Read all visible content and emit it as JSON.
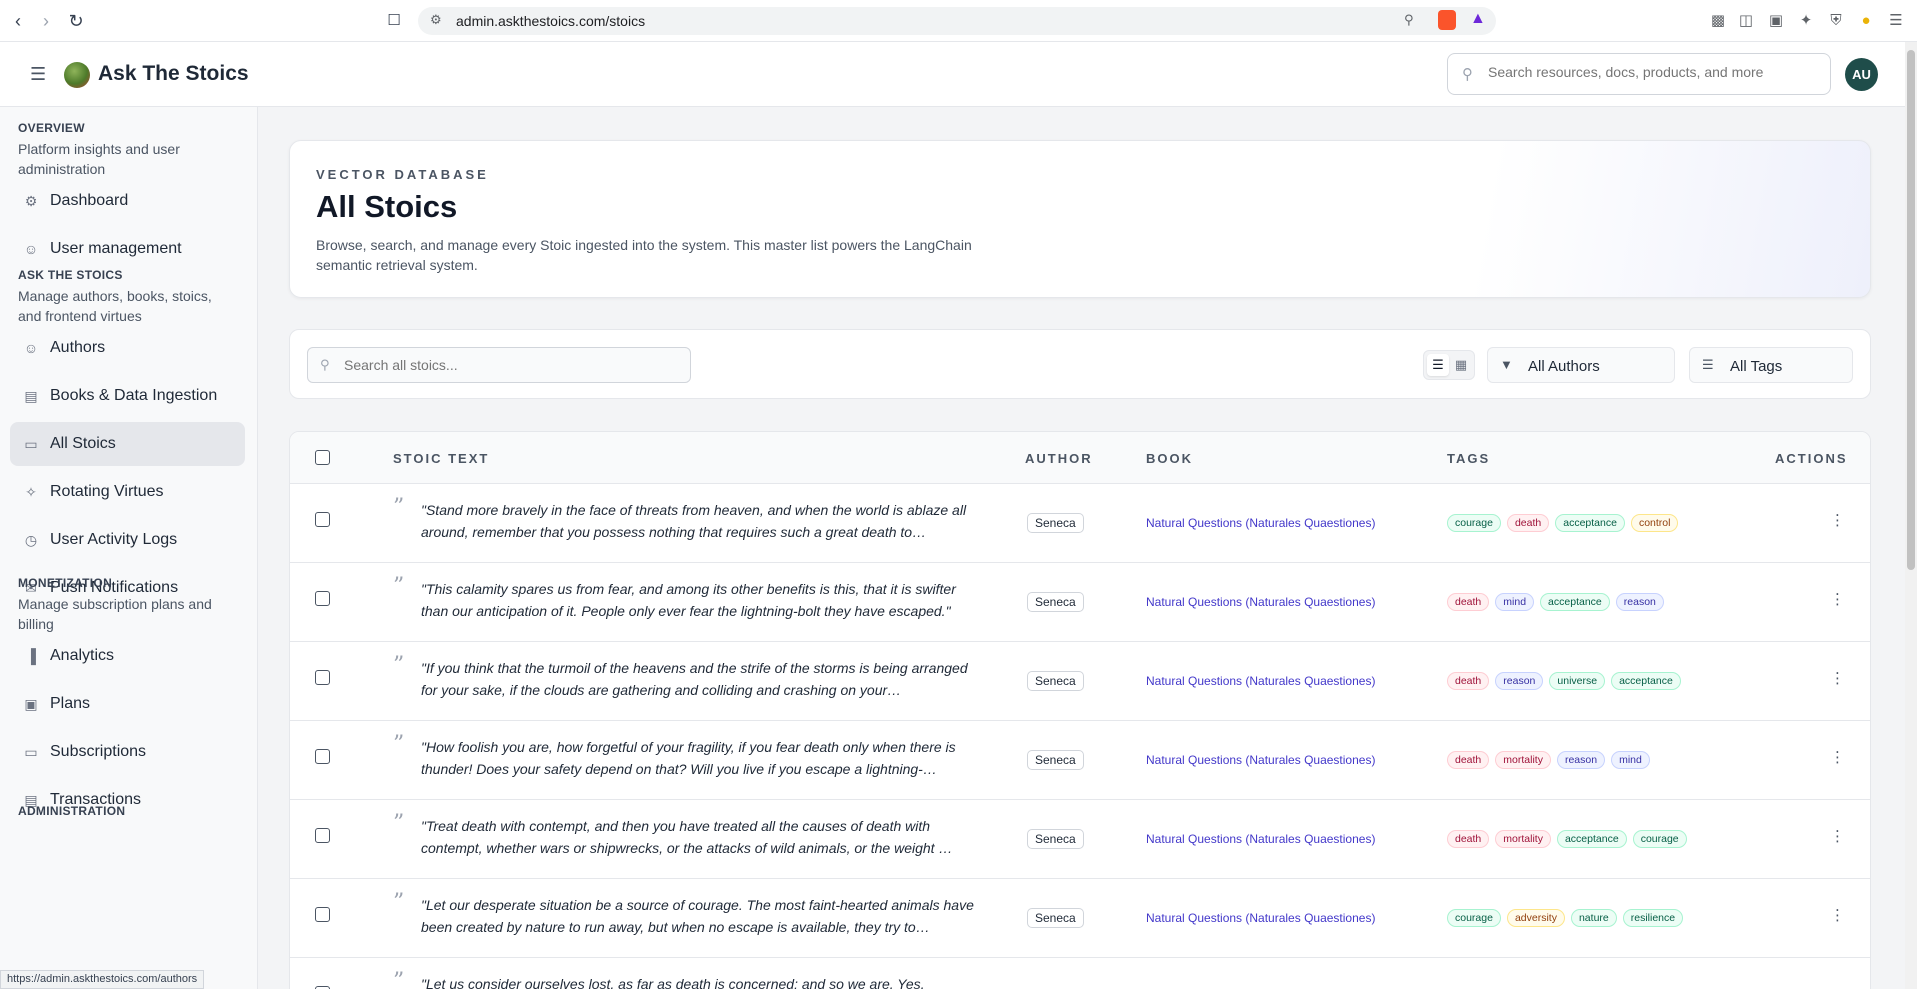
{
  "browser": {
    "url": "admin.askthestoics.com/stoics",
    "status_url": "https://admin.askthestoics.com/authors"
  },
  "header": {
    "brand": "Ask The Stoics",
    "search_placeholder": "Search resources, docs, products, and more",
    "avatar_initials": "AU"
  },
  "sidebar": {
    "sections": [
      {
        "title": "OVERVIEW",
        "desc": "Platform insights and user administration",
        "items": [
          {
            "label": "Dashboard",
            "icon": "gear-icon"
          },
          {
            "label": "User management",
            "icon": "users-icon"
          }
        ]
      },
      {
        "title": "ASK THE STOICS",
        "desc": "Manage authors, books, stoics, and frontend virtues",
        "items": [
          {
            "label": "Authors",
            "icon": "users-icon"
          },
          {
            "label": "Books & Data Ingestion",
            "icon": "book-icon"
          },
          {
            "label": "All Stoics",
            "icon": "message-icon",
            "active": true
          },
          {
            "label": "Rotating Virtues",
            "icon": "sparkles-icon"
          },
          {
            "label": "User Activity Logs",
            "icon": "clock-icon"
          },
          {
            "label": "Push Notifications",
            "icon": "mail-icon"
          }
        ]
      },
      {
        "title": "MONETIZATION",
        "desc": "Manage subscription plans and billing",
        "items": [
          {
            "label": "Analytics",
            "icon": "bar-chart-icon"
          },
          {
            "label": "Plans",
            "icon": "package-icon"
          },
          {
            "label": "Subscriptions",
            "icon": "credit-card-icon"
          },
          {
            "label": "Transactions",
            "icon": "receipt-icon"
          }
        ]
      },
      {
        "title": "ADMINISTRATION",
        "desc": "",
        "items": []
      }
    ]
  },
  "hero": {
    "eyebrow": "VECTOR DATABASE",
    "title": "All Stoics",
    "description": "Browse, search, and manage every Stoic ingested into the system. This master list powers the LangChain semantic retrieval system."
  },
  "toolbar": {
    "search_placeholder": "Search all stoics...",
    "author_filter": "All Authors",
    "tag_filter": "All Tags"
  },
  "table": {
    "columns": [
      "STOIC TEXT",
      "AUTHOR",
      "BOOK",
      "TAGS",
      "ACTIONS"
    ],
    "rows": [
      {
        "text": "\"Stand more bravely in the face of threats from heaven, and when the world is ablaze all around, remember that you possess nothing that requires such a great death to…",
        "author": "Seneca",
        "book": "Natural Questions (Naturales Quaestiones)",
        "tags": [
          "courage",
          "death",
          "acceptance",
          "control"
        ]
      },
      {
        "text": "\"This calamity spares us from fear, and among its other benefits is this, that it is swifter than our anticipation of it. People only ever fear the lightning-bolt they have escaped.\"",
        "author": "Seneca",
        "book": "Natural Questions (Naturales Quaestiones)",
        "tags": [
          "death",
          "mind",
          "acceptance",
          "reason"
        ]
      },
      {
        "text": "\"If you think that the turmoil of the heavens and the strife of the storms is being arranged for your sake, if the clouds are gathering and colliding and crashing on your…",
        "author": "Seneca",
        "book": "Natural Questions (Naturales Quaestiones)",
        "tags": [
          "death",
          "reason",
          "universe",
          "acceptance"
        ]
      },
      {
        "text": "\"How foolish you are, how forgetful of your fragility, if you fear death only when there is thunder! Does your safety depend on that? Will you live if you escape a lightning-…",
        "author": "Seneca",
        "book": "Natural Questions (Naturales Quaestiones)",
        "tags": [
          "death",
          "mortality",
          "reason",
          "mind"
        ]
      },
      {
        "text": "\"Treat death with contempt, and then you have treated all the causes of death with contempt, whether wars or shipwrecks, or the attacks of wild animals, or the weight …",
        "author": "Seneca",
        "book": "Natural Questions (Naturales Quaestiones)",
        "tags": [
          "death",
          "mortality",
          "acceptance",
          "courage"
        ]
      },
      {
        "text": "\"Let our desperate situation be a source of courage. The most faint-hearted animals have been created by nature to run away, but when no escape is available, they try to…",
        "author": "Seneca",
        "book": "Natural Questions (Naturales Quaestiones)",
        "tags": [
          "courage",
          "adversity",
          "nature",
          "resilience"
        ]
      },
      {
        "text": "\"Let us consider ourselves lost, as far as death is concerned; and so we are. Yes,",
        "author": "",
        "book": "",
        "tags": []
      }
    ]
  },
  "tag_colors": {
    "courage": {
      "bg": "#ecfdf5",
      "border": "#a7f3d0",
      "fg": "#065f46"
    },
    "acceptance": {
      "bg": "#ecfdf5",
      "border": "#a7f3d0",
      "fg": "#065f46"
    },
    "universe": {
      "bg": "#ecfdf5",
      "border": "#a7f3d0",
      "fg": "#065f46"
    },
    "nature": {
      "bg": "#ecfdf5",
      "border": "#a7f3d0",
      "fg": "#065f46"
    },
    "resilience": {
      "bg": "#ecfdf5",
      "border": "#a7f3d0",
      "fg": "#065f46"
    },
    "death": {
      "bg": "#fff1f2",
      "border": "#fecdd3",
      "fg": "#9f1239"
    },
    "mortality": {
      "bg": "#fff1f2",
      "border": "#fecdd3",
      "fg": "#9f1239"
    },
    "control": {
      "bg": "#fffbeb",
      "border": "#fde68a",
      "fg": "#92400e"
    },
    "adversity": {
      "bg": "#fffbeb",
      "border": "#fde68a",
      "fg": "#92400e"
    },
    "mind": {
      "bg": "#eef2ff",
      "border": "#c7d2fe",
      "fg": "#3730a3"
    },
    "reason": {
      "bg": "#eef2ff",
      "border": "#c7d2fe",
      "fg": "#3730a3"
    }
  }
}
